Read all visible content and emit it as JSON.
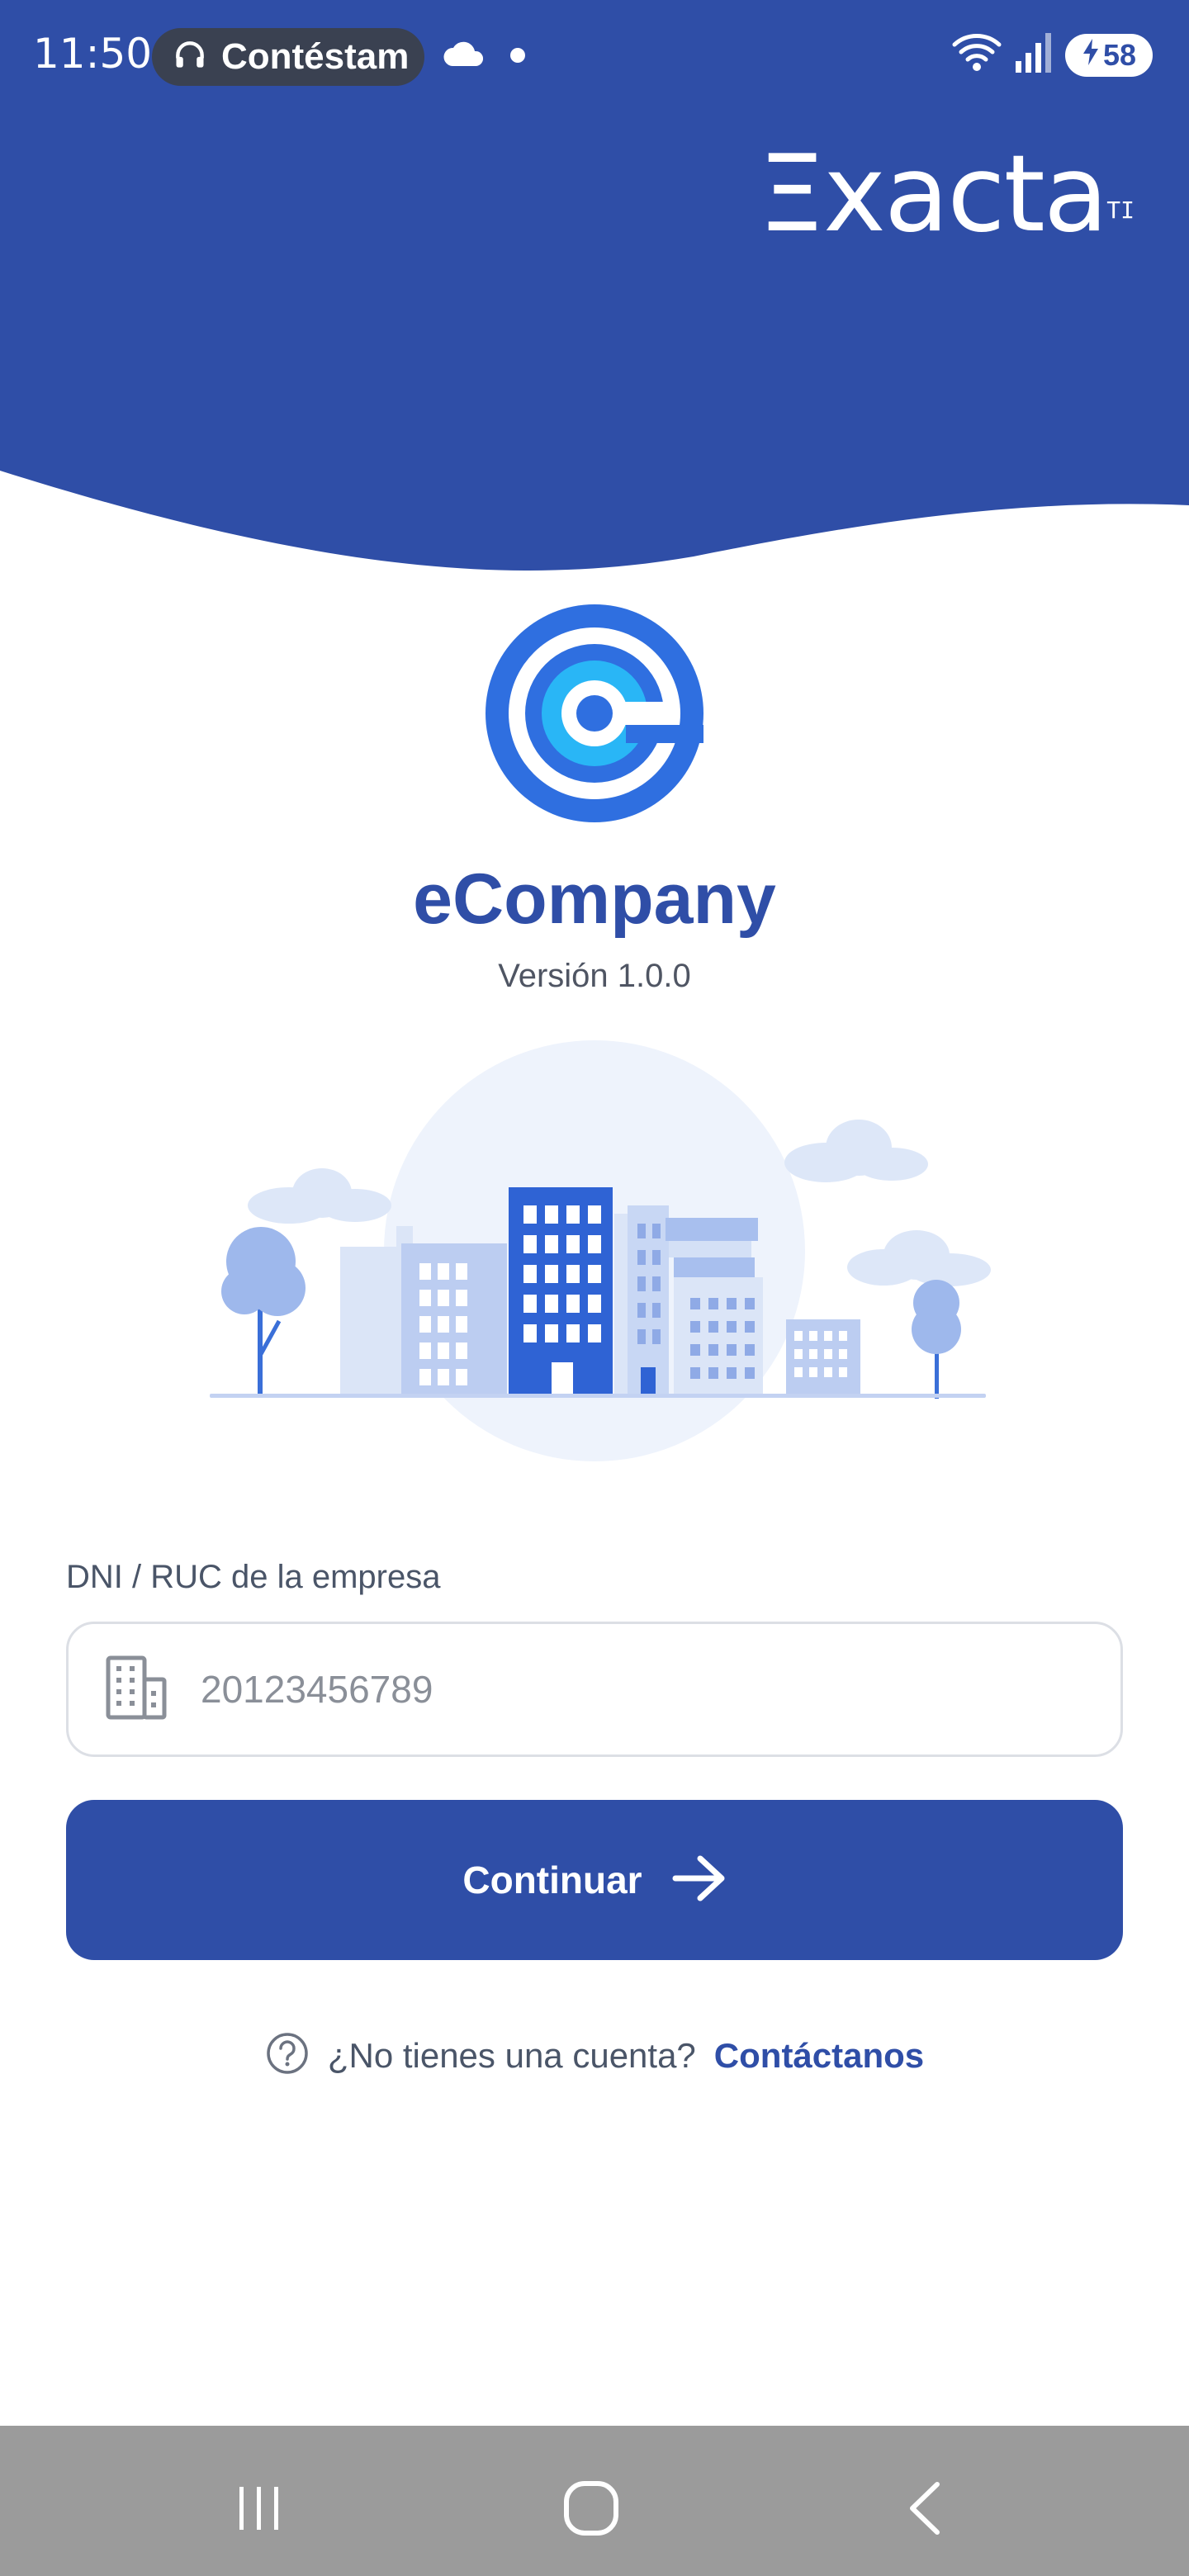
{
  "colors": {
    "primary": "#2f4ea7",
    "header": "#2f4ea7",
    "text_muted": "#4a5568",
    "nav_bar": "#9b9b9b"
  },
  "status_bar": {
    "time": "11:50",
    "media_text": "Contéstam",
    "media_icon": "headphones-icon",
    "battery": "58"
  },
  "brand": {
    "logo_text": "Ξxacta",
    "logo_mark": "TI"
  },
  "app": {
    "name": "eCompany",
    "version": "Versión 1.0.0"
  },
  "form": {
    "label": "DNI / RUC de la empresa",
    "input_value": "",
    "input_placeholder": "20123456789",
    "input_icon": "building-icon",
    "continue_label": "Continuar"
  },
  "help": {
    "icon": "question-circle-icon",
    "text": "¿No tienes una cuenta?",
    "link": "Contáctanos"
  },
  "nav": {
    "recents": "recents-icon",
    "home": "home-icon",
    "back": "back-icon"
  }
}
